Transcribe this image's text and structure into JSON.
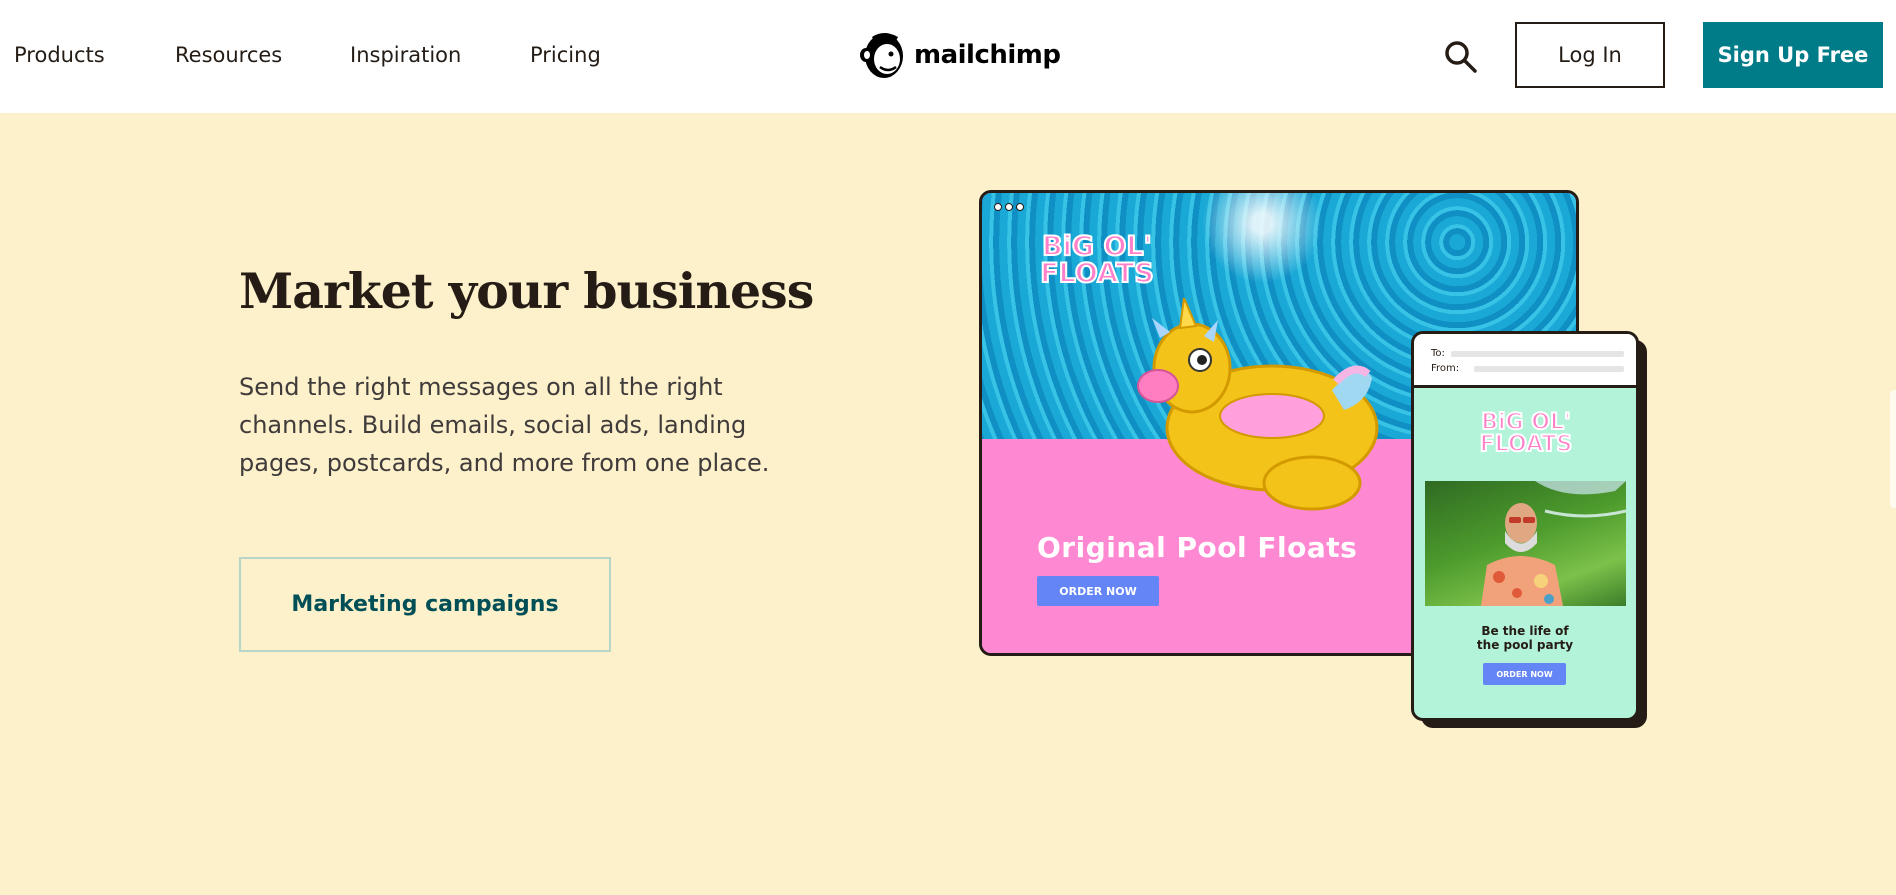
{
  "nav": {
    "items": [
      {
        "label": "Products"
      },
      {
        "label": "Resources"
      },
      {
        "label": "Inspiration"
      },
      {
        "label": "Pricing"
      }
    ],
    "logo_text": "mailchimp",
    "login_label": "Log In",
    "signup_label": "Sign Up Free"
  },
  "hero": {
    "title": "Market your business",
    "description": "Send the right messages on all the right channels. Build emails, social ads, landing pages, postcards, and more from one place.",
    "cta_label": "Marketing campaigns"
  },
  "illustration": {
    "desktop": {
      "brand": "BiG OL' FLOATS",
      "headline": "Original Pool Floats",
      "button": "ORDER NOW"
    },
    "phone": {
      "to_label": "To:",
      "from_label": "From:",
      "brand": "BiG OL' FLOATS",
      "tagline_line1": "Be the life of",
      "tagline_line2": "the pool party",
      "button": "ORDER NOW"
    }
  },
  "colors": {
    "background": "#fdf1cb",
    "accent": "#007c89",
    "pink": "#ff88d2",
    "mint": "#b2f3d9",
    "order_button": "#6385f5"
  }
}
